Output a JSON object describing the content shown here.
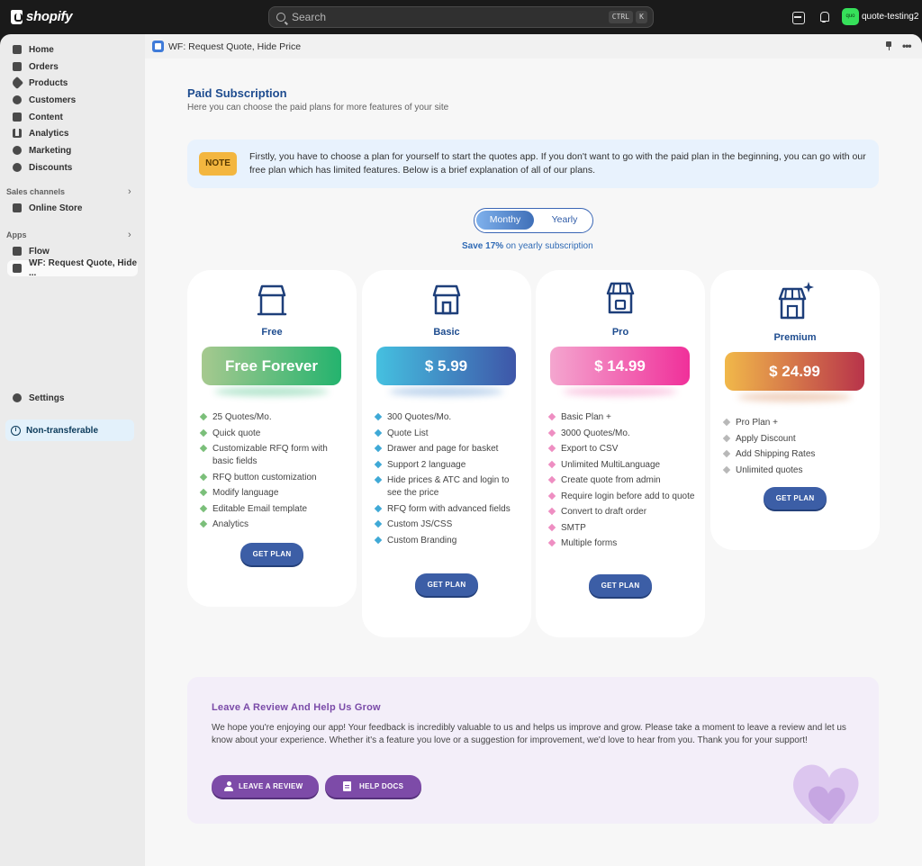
{
  "topbar": {
    "brand": "shopify",
    "search_placeholder": "Search",
    "kbd_ctrl": "CTRL",
    "kbd_k": "K",
    "store_avatar_text": "quo",
    "store_name": "quote-testing2"
  },
  "sidebar": {
    "items": [
      {
        "label": "Home",
        "icon": "home-icon"
      },
      {
        "label": "Orders",
        "icon": "orders-icon"
      },
      {
        "label": "Products",
        "icon": "tag-icon"
      },
      {
        "label": "Customers",
        "icon": "person-icon"
      },
      {
        "label": "Content",
        "icon": "content-icon"
      },
      {
        "label": "Analytics",
        "icon": "bar-chart-icon"
      },
      {
        "label": "Marketing",
        "icon": "target-icon"
      },
      {
        "label": "Discounts",
        "icon": "discount-icon"
      }
    ],
    "sales_channels_label": "Sales channels",
    "online_store": "Online Store",
    "apps_label": "Apps",
    "flow": "Flow",
    "app_active": "WF: Request Quote, Hide ...",
    "settings": "Settings",
    "non_transferable": "Non-transferable"
  },
  "app": {
    "title": "WF: Request Quote, Hide Price"
  },
  "subscription": {
    "title": "Paid Subscription",
    "description": "Here you can choose the paid plans for more features of your site",
    "note_badge": "NOTE",
    "note_text": "Firstly, you have to choose a plan for yourself to start the quotes app. If you don't want to go with the paid plan in the beginning, you can go with our free plan which has limited features. Below is a brief explanation of all of our plans.",
    "toggle_monthly": "Monthy",
    "toggle_yearly": "Yearly",
    "save_bold": "Save 17%",
    "save_rest": " on yearly subscription"
  },
  "plans": [
    {
      "name": "Free",
      "price": "Free Forever",
      "button": "GET PLAN",
      "features": [
        "25 Quotes/Mo.",
        "Quick quote",
        "Customizable RFQ form with basic fields",
        "RFQ button customization",
        "Modify language",
        "Editable Email template",
        "Analytics"
      ],
      "colors": {
        "from": "#a6c98f",
        "to": "#24b36e",
        "dot": "#7bbf7a"
      }
    },
    {
      "name": "Basic",
      "price": "$ 5.99",
      "button": "GET PLAN",
      "features": [
        "300 Quotes/Mo.",
        "Quote List",
        "Drawer and page for basket",
        "Support 2 language",
        "Hide prices & ATC and login to see the price",
        "RFQ form with advanced fields",
        "Custom JS/CSS",
        "Custom Branding"
      ],
      "colors": {
        "from": "#45c0e0",
        "to": "#3e56a8",
        "dot": "#3fa9d6"
      }
    },
    {
      "name": "Pro",
      "price": "$ 14.99",
      "button": "GET PLAN",
      "features": [
        "Basic Plan +",
        "3000 Quotes/Mo.",
        "Export to CSV",
        "Unlimited MultiLanguage",
        "Create quote from admin",
        "Require login before add to quote",
        "Convert to draft order",
        "SMTP",
        "Multiple forms"
      ],
      "colors": {
        "from": "#f4a6cf",
        "to": "#f0309a",
        "dot": "#ee8ec2"
      }
    },
    {
      "name": "Premium",
      "price": "$ 24.99",
      "button": "GET PLAN",
      "features": [
        "Pro Plan +",
        "Apply Discount",
        "Add Shipping Rates",
        "Unlimited quotes"
      ],
      "colors": {
        "from": "#f1b84a",
        "to": "#b8334a",
        "dot": "#b8b8b8"
      }
    }
  ],
  "review": {
    "title": "Leave A Review And Help Us Grow",
    "text": "We hope you're enjoying our app! Your feedback is incredibly valuable to us and helps us improve and grow. Please take a moment to leave a review and let us know about your experience. Whether it's a feature you love or a suggestion for improvement, we'd love to hear from you. Thank you for your support!",
    "leave_review": "LEAVE A REVIEW",
    "help_docs": "HELP DOCS"
  }
}
